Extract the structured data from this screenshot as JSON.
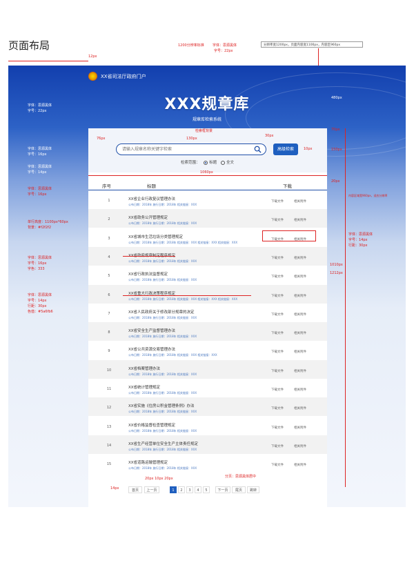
{
  "page_heading": "页面布局",
  "top_annotations": {
    "a": "1200分辨率标准",
    "b": "字体：思源黑体",
    "c": "字号：22px",
    "box": "分辨率宽1200px，页面内容宽1100px，内容区960px"
  },
  "header": {
    "site_name": "XX省司法厅政府门户",
    "title": "XXX规章库",
    "subtitle": "规章库检索系统"
  },
  "search": {
    "placeholder": "请输入规章名称关键字检索",
    "button_label": "高级检索",
    "option_label": "检索范围：",
    "option_a": "标题",
    "option_b": "全文"
  },
  "table": {
    "col_no": "序号",
    "col_title": "标题",
    "col_download": "下载",
    "rows": [
      {
        "no": "1",
        "title": "XX省企业行政复议管理办法",
        "links": "公布日期：2018年 施行日期：2018年    相关链接：XXX    ",
        "dl_a": "下载文件",
        "dl_b": "相关附件"
      },
      {
        "no": "2",
        "title": "XX省政务公开管理规定",
        "links": "公布日期：2018年 施行日期：2018年    相关链接：XXX    ",
        "dl_a": "下载文件",
        "dl_b": "相关附件"
      },
      {
        "no": "3",
        "title": "XX省城市生活垃圾分类管理规定",
        "links": "公布日期：2018年 施行日期：2018年    相关链接：XXX 相关链接：XXX 相关链接：XXX",
        "dl_a": "下载文件",
        "dl_b": "相关附件"
      },
      {
        "no": "4",
        "title": "XX省政府规章制定程序规定",
        "links": "公布日期：2018年 施行日期：2018年    相关链接：XXX    ",
        "dl_a": "下载文件",
        "dl_b": "相关附件"
      },
      {
        "no": "5",
        "title": "XX省行政执法监督规定",
        "links": "公布日期：2018年 施行日期：2018年    相关链接：XXX    ",
        "dl_a": "下载文件",
        "dl_b": "相关附件"
      },
      {
        "no": "6",
        "title": "XX省重大行政决策程序规定",
        "links": "公布日期：2018年 施行日期：2018年    相关链接：XXX 相关链接：XXX 相关链接：XXX",
        "dl_a": "下载文件",
        "dl_b": "相关附件"
      },
      {
        "no": "7",
        "title": "XX省人民政府关于修改部分规章的决定",
        "links": "公布日期：2018年 施行日期：2018年    相关链接：XXX    ",
        "dl_a": "下载文件",
        "dl_b": "相关附件"
      },
      {
        "no": "8",
        "title": "XX省安全生产监督管理办法",
        "links": "公布日期：2018年 施行日期：2018年    相关链接：XXX    ",
        "dl_a": "下载文件",
        "dl_b": "相关附件"
      },
      {
        "no": "9",
        "title": "XX省公共资源交易管理办法",
        "links": "公布日期：2018年 施行日期：2018年    相关链接：XXX 相关链接：XXX",
        "dl_a": "下载文件",
        "dl_b": "相关附件"
      },
      {
        "no": "10",
        "title": "XX省档案管理办法",
        "links": "公布日期：2018年 施行日期：2018年    相关链接：XXX    ",
        "dl_a": "下载文件",
        "dl_b": "相关附件"
      },
      {
        "no": "11",
        "title": "XX省统计管理规定",
        "links": "公布日期：2018年 施行日期：2018年    相关链接：XXX    ",
        "dl_a": "下载文件",
        "dl_b": "相关附件"
      },
      {
        "no": "12",
        "title": "XX省实施《住房公积金管理条例》办法",
        "links": "公布日期：2018年 施行日期：2018年    相关链接：XXX    ",
        "dl_a": "下载文件",
        "dl_b": "相关附件"
      },
      {
        "no": "13",
        "title": "XX省价格监督检查管理规定",
        "links": "公布日期：2018年 施行日期：2018年    相关链接：XXX    ",
        "dl_a": "下载文件",
        "dl_b": "相关附件"
      },
      {
        "no": "14",
        "title": "XX省生产经营单位安全生产主体责任规定",
        "links": "公布日期：2018年 施行日期：2018年    相关链接：XXX    ",
        "dl_a": "下载文件",
        "dl_b": "相关附件"
      },
      {
        "no": "15",
        "title": "XX省道路运输管理规定",
        "links": "公布日期：2018年 施行日期：2018年    相关链接：XXX    ",
        "dl_a": "下载文件",
        "dl_b": "相关附件"
      }
    ]
  },
  "pager": {
    "first": "首页",
    "prev": "上一页",
    "pages": [
      "1",
      "2",
      "3",
      "4",
      "5"
    ],
    "next": "下一页",
    "last": "尾页",
    "goto": "跳转"
  },
  "annotations": {
    "px_12": "12px",
    "left_title_1": "字体：思源黑体",
    "left_title_2": "字号：22px",
    "right_480": "480px",
    "right_70": "70px",
    "right_150": "150px",
    "right_20": "20px",
    "right_1010": "1010px",
    "right_1212": "1212px",
    "right_10": "10px",
    "mid_1060": "1060px",
    "box_76": "76px",
    "box_130": "130px",
    "search_note": "检索框背景",
    "search_30": "30px",
    "left_s1": "字体：思源黑体",
    "left_s2": "字号：16px",
    "left_o1": "字体：思源黑体",
    "left_o2": "字号：14px",
    "left_h1": "字体：思源黑体",
    "left_h2": "字号：16px",
    "left_r1": "单行高度：1100px*60px",
    "left_r2": "背景：#f2f2f2",
    "left_t1": "字体：思源黑体",
    "left_t2": "字号：16px",
    "left_t3": "字色：333",
    "left_l1": "字体：思源黑体",
    "left_l2": "字号：14px",
    "left_l3": "行距：30px",
    "left_l4": "色值：#5a6fb6",
    "right_d1": "字体：思源黑体",
    "right_d2": "字号：14px",
    "right_d3": "行距：30px",
    "right_cont": "内容区域宽960px，适应分辨率",
    "pager_note": "分页：思源黑体居中",
    "pager_sizes": "20px 10px 20px",
    "pager_14": "14px"
  }
}
